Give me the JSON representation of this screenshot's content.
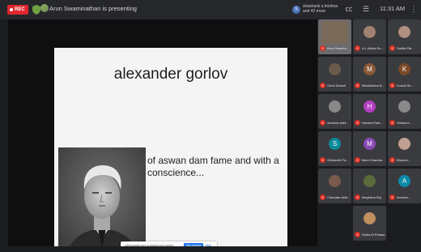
{
  "topbar": {
    "rec_label": "REC",
    "presenting": "Arun Swaminathan is presenting",
    "present_chip": {
      "avatar_letter": "S",
      "text": "shashank a krishna and 42 more"
    },
    "time": "11:31 AM"
  },
  "slide": {
    "title": "alexander gorlov",
    "body": "of aswan dam fame and with a conscience..."
  },
  "screenshare": {
    "text": "meet.google.com is sharing your screen",
    "stop_label": "Stop sharing",
    "hide_label": "Hide"
  },
  "participants": [
    {
      "name": "Arun Swamin...",
      "letter": "",
      "color": "#7a6a5a",
      "self": true
    },
    {
      "name": "A.L.Arthia Se...",
      "letter": "",
      "color": "#a08070"
    },
    {
      "name": "Sahita Pal...",
      "letter": "",
      "color": "#b09080"
    },
    {
      "name": "Gumi Dinesh",
      "letter": "",
      "color": "#6b5a4a"
    },
    {
      "name": "Madhukima B...",
      "letter": "M",
      "color": "#8a5a3c"
    },
    {
      "name": "Komal Sh...",
      "letter": "K",
      "color": "#7a4a2a"
    },
    {
      "name": "shubhra shet...",
      "letter": "",
      "color": "#888888"
    },
    {
      "name": "Harsha Pant...",
      "letter": "H",
      "color": "#b43fc0"
    },
    {
      "name": "Shrikant...",
      "letter": "",
      "color": "#8a8a8a"
    },
    {
      "name": "Shrikanth Pa...",
      "letter": "S",
      "color": "#0a8a9a"
    },
    {
      "name": "Mani Chandra",
      "letter": "M",
      "color": "#8a4ab4"
    },
    {
      "name": "Bhoomi...",
      "letter": "",
      "color": "#c0a090"
    },
    {
      "name": "Chandan Asth...",
      "letter": "",
      "color": "#7a5a4a"
    },
    {
      "name": "Meghana Raj",
      "letter": "",
      "color": "#5a6a3a"
    },
    {
      "name": "Anusha...",
      "letter": "A",
      "color": "#0a8aa8"
    },
    {
      "name": "Shiba M Prasan...",
      "letter": "",
      "color": "#c09060"
    }
  ]
}
